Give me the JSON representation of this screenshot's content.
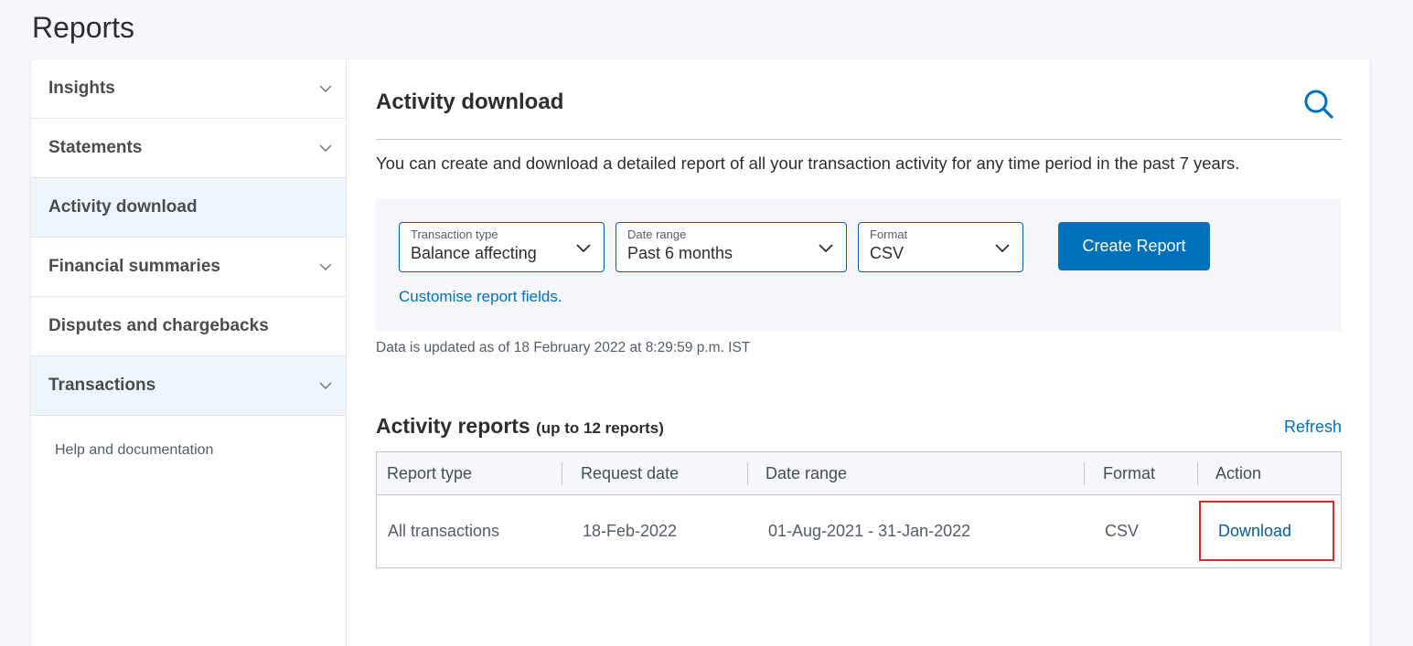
{
  "page": {
    "title": "Reports"
  },
  "sidebar": {
    "items": [
      {
        "label": "Insights"
      },
      {
        "label": "Statements"
      },
      {
        "label": "Activity download"
      },
      {
        "label": "Financial summaries"
      },
      {
        "label": "Disputes and chargebacks"
      },
      {
        "label": "Transactions"
      }
    ],
    "help_label": "Help and documentation"
  },
  "main": {
    "title": "Activity download",
    "intro": "You can create and download a detailed report of all your transaction activity for any time period in the past 7 years.",
    "filters": {
      "transaction_type": {
        "label": "Transaction type",
        "value": "Balance affecting"
      },
      "date_range": {
        "label": "Date range",
        "value": "Past 6 months"
      },
      "format": {
        "label": "Format",
        "value": "CSV"
      },
      "create_label": "Create Report",
      "customise_label": "Customise report fields."
    },
    "updated_text": "Data is updated as of 18 February 2022 at 8:29:59 p.m. IST",
    "reports": {
      "title": "Activity reports",
      "subtitle": "(up to 12 reports)",
      "refresh_label": "Refresh",
      "columns": [
        "Report type",
        "Request date",
        "Date range",
        "Format",
        "Action"
      ],
      "rows": [
        {
          "report_type": "All transactions",
          "request_date": "18-Feb-2022",
          "date_range": "01-Aug-2021 - 31-Jan-2022",
          "format": "CSV",
          "action": "Download"
        }
      ]
    }
  },
  "colors": {
    "accent": "#0070ba",
    "link": "#0b5ca0",
    "highlight": "#e0242b",
    "active_nav_bg": "#eef5fb"
  },
  "icons": {
    "search": "search-icon",
    "chevron": "chevron-down-icon"
  }
}
